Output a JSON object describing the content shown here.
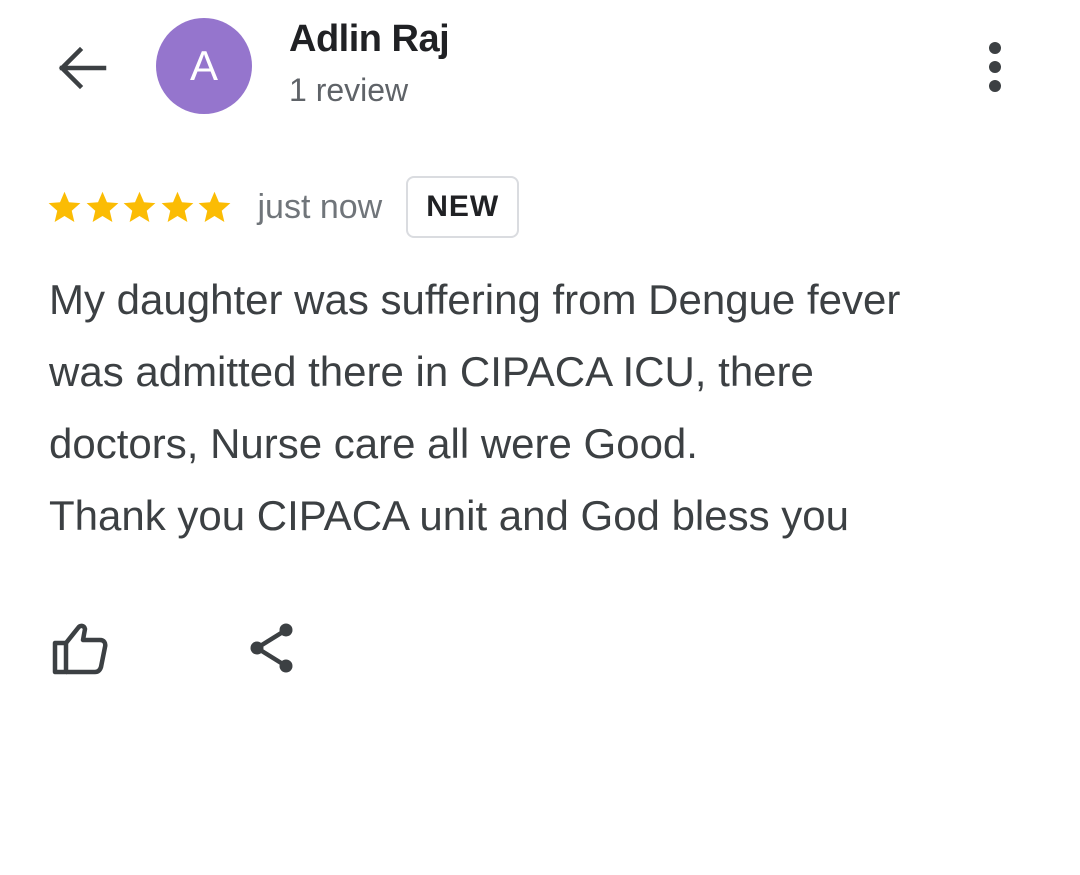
{
  "header": {
    "back_icon": "arrow-left-icon",
    "avatar_letter": "A",
    "avatar_color": "#9575cd",
    "reviewer_name": "Adlin Raj",
    "review_count": "1 review",
    "more_icon": "more-vertical-icon"
  },
  "review": {
    "rating": 5,
    "max_rating": 5,
    "star_color": "#fbbc04",
    "timestamp": "just now",
    "badge": "NEW",
    "text": "My daughter was suffering from Dengue fever\nwas admitted there in CIPACA ICU, there\ndoctors, Nurse care all were Good.\nThank you CIPACA unit and God bless you"
  },
  "actions": {
    "like_icon": "thumbs-up-icon",
    "share_icon": "share-icon"
  }
}
